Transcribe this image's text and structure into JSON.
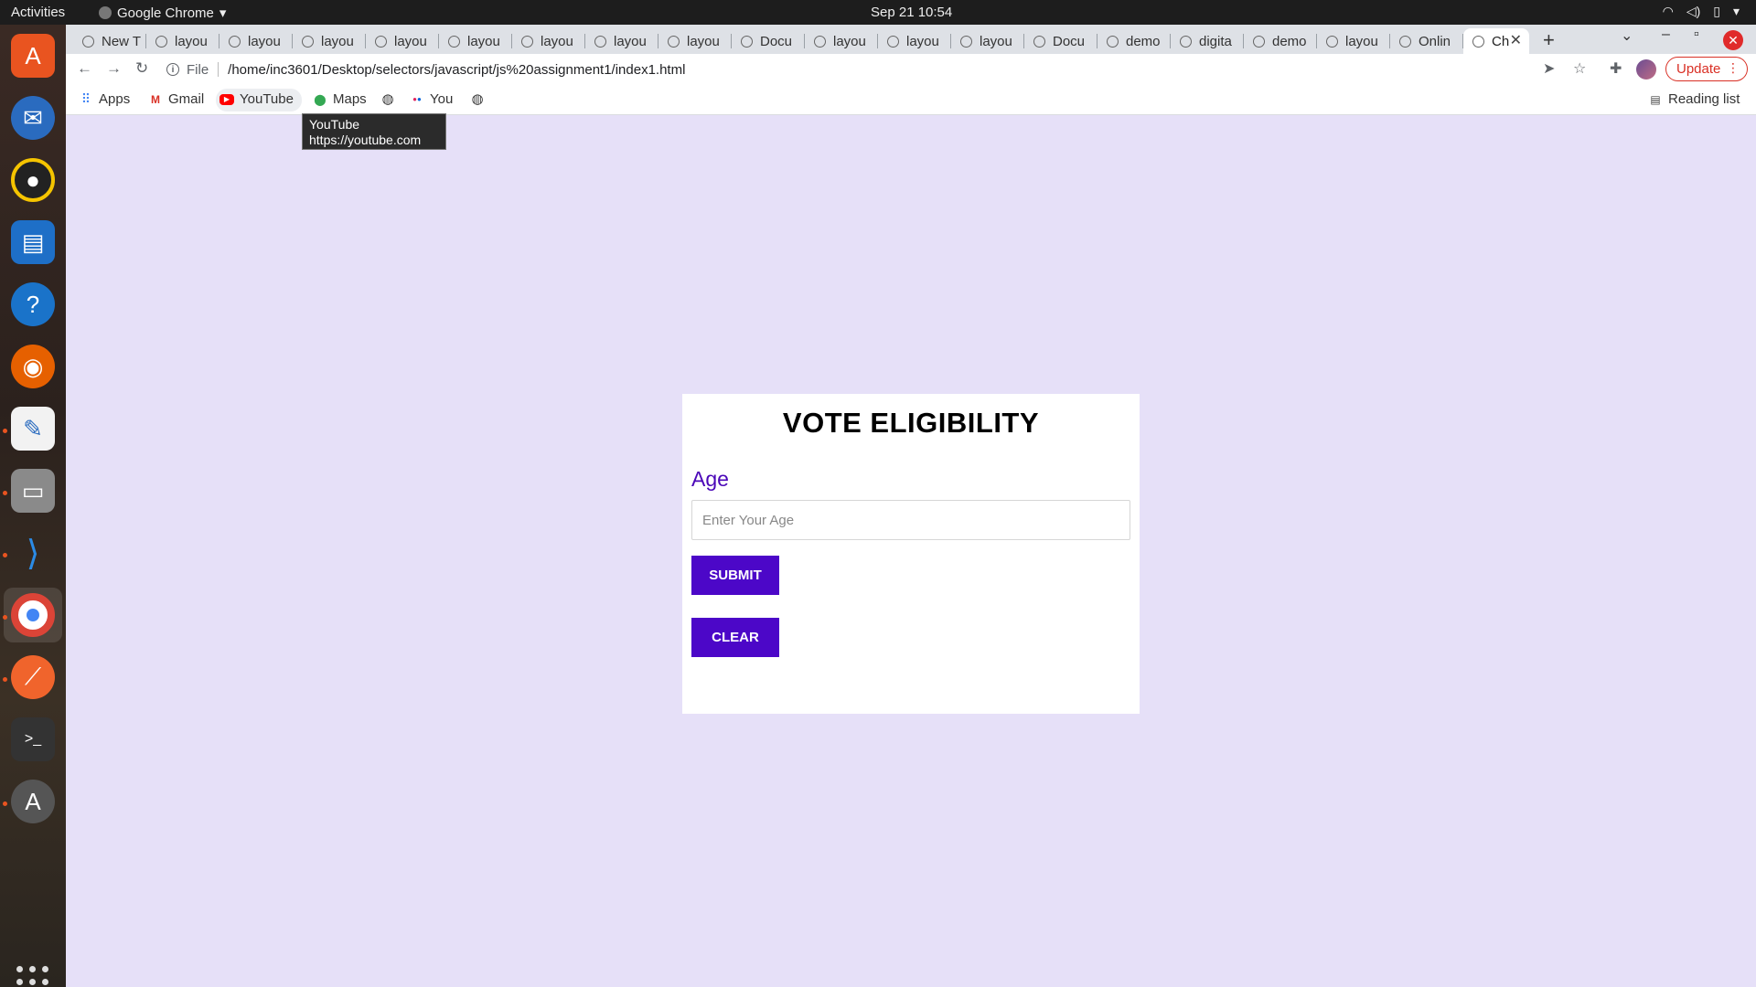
{
  "system": {
    "activities": "Activities",
    "app_name": "Google Chrome",
    "clock": "Sep 21  10:54"
  },
  "browser": {
    "tabs": [
      "New T",
      "layou",
      "layou",
      "layou",
      "layou",
      "layou",
      "layou",
      "layou",
      "layou",
      "Docu",
      "layou",
      "layou",
      "layou",
      "Docu",
      "demo",
      "digita",
      "demo",
      "layou",
      "Onlin"
    ],
    "active_tab": "Ch",
    "address_scheme": "File",
    "url": "/home/inc3601/Desktop/selectors/javascript/js%20assignment1/index1.html",
    "update_label": "Update",
    "bookmarks": {
      "apps": "Apps",
      "gmail": "Gmail",
      "youtube": "YouTube",
      "maps": "Maps",
      "you": "You",
      "reading_list": "Reading list"
    },
    "tooltip": {
      "title": "YouTube",
      "url": "https://youtube.com"
    }
  },
  "form": {
    "title": "VOTE ELIGIBILITY",
    "age_label": "Age",
    "age_placeholder": "Enter Your Age",
    "age_value": "",
    "submit_label": "SUBMIT",
    "clear_label": "CLEAR"
  },
  "colors": {
    "page_background": "#e6e0f8",
    "accent": "#4c07c8",
    "label": "#4b07b8"
  }
}
